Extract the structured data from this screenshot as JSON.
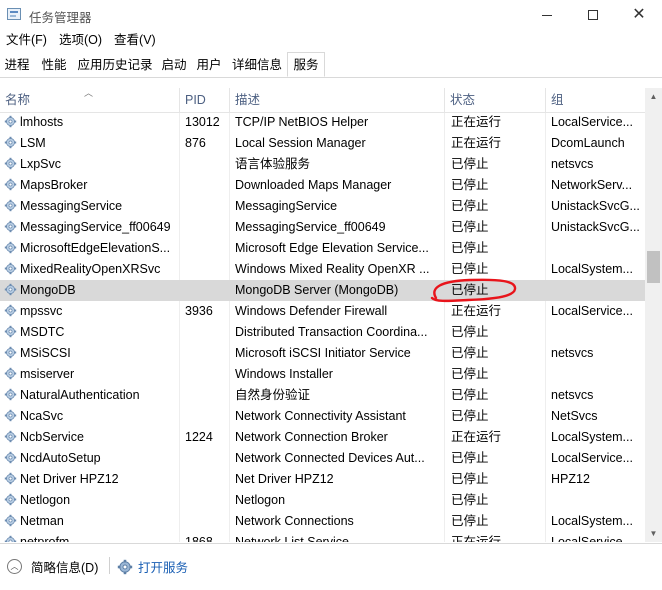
{
  "window": {
    "title": "任务管理器"
  },
  "menu": [
    "文件(F)",
    "选项(O)",
    "查看(V)"
  ],
  "tabs": [
    "进程",
    "性能",
    "应用历史记录",
    "启动",
    "用户",
    "详细信息",
    "服务"
  ],
  "active_tab": "服务",
  "columns": {
    "name": "名称",
    "pid": "PID",
    "desc": "描述",
    "status": "状态",
    "group": "组"
  },
  "rows": [
    {
      "name": "lmhosts",
      "pid": "13012",
      "desc": "TCP/IP NetBIOS Helper",
      "status": "正在运行",
      "group": "LocalService..."
    },
    {
      "name": "LSM",
      "pid": "876",
      "desc": "Local Session Manager",
      "status": "正在运行",
      "group": "DcomLaunch"
    },
    {
      "name": "LxpSvc",
      "pid": "",
      "desc": "语言体验服务",
      "status": "已停止",
      "group": "netsvcs"
    },
    {
      "name": "MapsBroker",
      "pid": "",
      "desc": "Downloaded Maps Manager",
      "status": "已停止",
      "group": "NetworkServ..."
    },
    {
      "name": "MessagingService",
      "pid": "",
      "desc": "MessagingService",
      "status": "已停止",
      "group": "UnistackSvcG..."
    },
    {
      "name": "MessagingService_ff00649",
      "pid": "",
      "desc": "MessagingService_ff00649",
      "status": "已停止",
      "group": "UnistackSvcG..."
    },
    {
      "name": "MicrosoftEdgeElevationS...",
      "pid": "",
      "desc": "Microsoft Edge Elevation Service...",
      "status": "已停止",
      "group": ""
    },
    {
      "name": "MixedRealityOpenXRSvc",
      "pid": "",
      "desc": "Windows Mixed Reality OpenXR ...",
      "status": "已停止",
      "group": "LocalSystem..."
    },
    {
      "name": "MongoDB",
      "pid": "",
      "desc": "MongoDB Server (MongoDB)",
      "status": "已停止",
      "group": "",
      "selected": true
    },
    {
      "name": "mpssvc",
      "pid": "3936",
      "desc": "Windows Defender Firewall",
      "status": "正在运行",
      "group": "LocalService..."
    },
    {
      "name": "MSDTC",
      "pid": "",
      "desc": "Distributed Transaction Coordina...",
      "status": "已停止",
      "group": ""
    },
    {
      "name": "MSiSCSI",
      "pid": "",
      "desc": "Microsoft iSCSI Initiator Service",
      "status": "已停止",
      "group": "netsvcs"
    },
    {
      "name": "msiserver",
      "pid": "",
      "desc": "Windows Installer",
      "status": "已停止",
      "group": ""
    },
    {
      "name": "NaturalAuthentication",
      "pid": "",
      "desc": "自然身份验证",
      "status": "已停止",
      "group": "netsvcs"
    },
    {
      "name": "NcaSvc",
      "pid": "",
      "desc": "Network Connectivity Assistant",
      "status": "已停止",
      "group": "NetSvcs"
    },
    {
      "name": "NcbService",
      "pid": "1224",
      "desc": "Network Connection Broker",
      "status": "正在运行",
      "group": "LocalSystem..."
    },
    {
      "name": "NcdAutoSetup",
      "pid": "",
      "desc": "Network Connected Devices Aut...",
      "status": "已停止",
      "group": "LocalService..."
    },
    {
      "name": "Net Driver HPZ12",
      "pid": "",
      "desc": "Net Driver HPZ12",
      "status": "已停止",
      "group": "HPZ12"
    },
    {
      "name": "Netlogon",
      "pid": "",
      "desc": "Netlogon",
      "status": "已停止",
      "group": ""
    },
    {
      "name": "Netman",
      "pid": "",
      "desc": "Network Connections",
      "status": "已停止",
      "group": "LocalSystem..."
    },
    {
      "name": "netprofm",
      "pid": "1868",
      "desc": "Network List Service",
      "status": "正在运行",
      "group": "LocalService..."
    }
  ],
  "footer": {
    "fewer_details": "简略信息(D)",
    "open_services": "打开服务"
  },
  "colors": {
    "annotation": "#e8141b",
    "selected_row": "#d9d9d9",
    "header_text": "#4d6082",
    "link": "#1a5fb4"
  },
  "icons": {
    "service": "gear-icon",
    "fewer_details": "chevron-up-circle-icon",
    "open_services": "gear-icon"
  }
}
